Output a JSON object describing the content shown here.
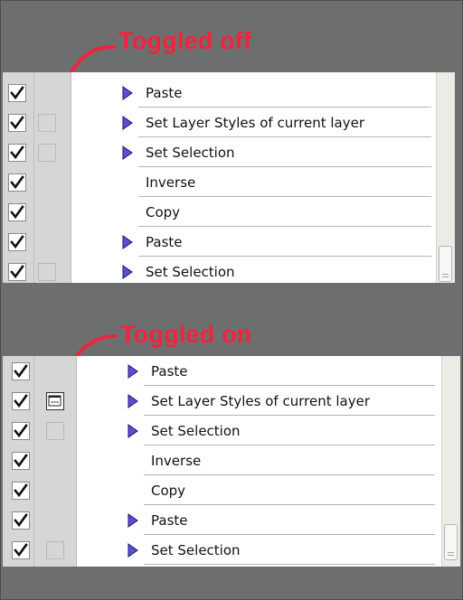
{
  "callouts": {
    "off": "Toggled off",
    "on": "Toggled on"
  },
  "colors": {
    "callout": "#f0243c",
    "background": "#6d6f6f",
    "triangle": "#5a4fd6"
  },
  "panels": [
    {
      "name": "toggled-off",
      "rows": [
        {
          "checked": true,
          "dialog": "none",
          "expand": true,
          "label": "Paste"
        },
        {
          "checked": true,
          "dialog": "off",
          "expand": true,
          "label": "Set Layer Styles of current layer"
        },
        {
          "checked": true,
          "dialog": "off",
          "expand": true,
          "label": "Set Selection"
        },
        {
          "checked": true,
          "dialog": "none",
          "expand": false,
          "label": "Inverse"
        },
        {
          "checked": true,
          "dialog": "none",
          "expand": false,
          "label": "Copy"
        },
        {
          "checked": true,
          "dialog": "none",
          "expand": true,
          "label": "Paste"
        },
        {
          "checked": true,
          "dialog": "off",
          "expand": true,
          "label": "Set Selection"
        }
      ]
    },
    {
      "name": "toggled-on",
      "rows": [
        {
          "checked": true,
          "dialog": "none",
          "expand": true,
          "label": "Paste"
        },
        {
          "checked": true,
          "dialog": "on",
          "expand": true,
          "label": "Set Layer Styles of current layer"
        },
        {
          "checked": true,
          "dialog": "off",
          "expand": true,
          "label": "Set Selection"
        },
        {
          "checked": true,
          "dialog": "none",
          "expand": false,
          "label": "Inverse"
        },
        {
          "checked": true,
          "dialog": "none",
          "expand": false,
          "label": "Copy"
        },
        {
          "checked": true,
          "dialog": "none",
          "expand": true,
          "label": "Paste"
        },
        {
          "checked": true,
          "dialog": "off",
          "expand": true,
          "label": "Set Selection"
        }
      ]
    }
  ]
}
